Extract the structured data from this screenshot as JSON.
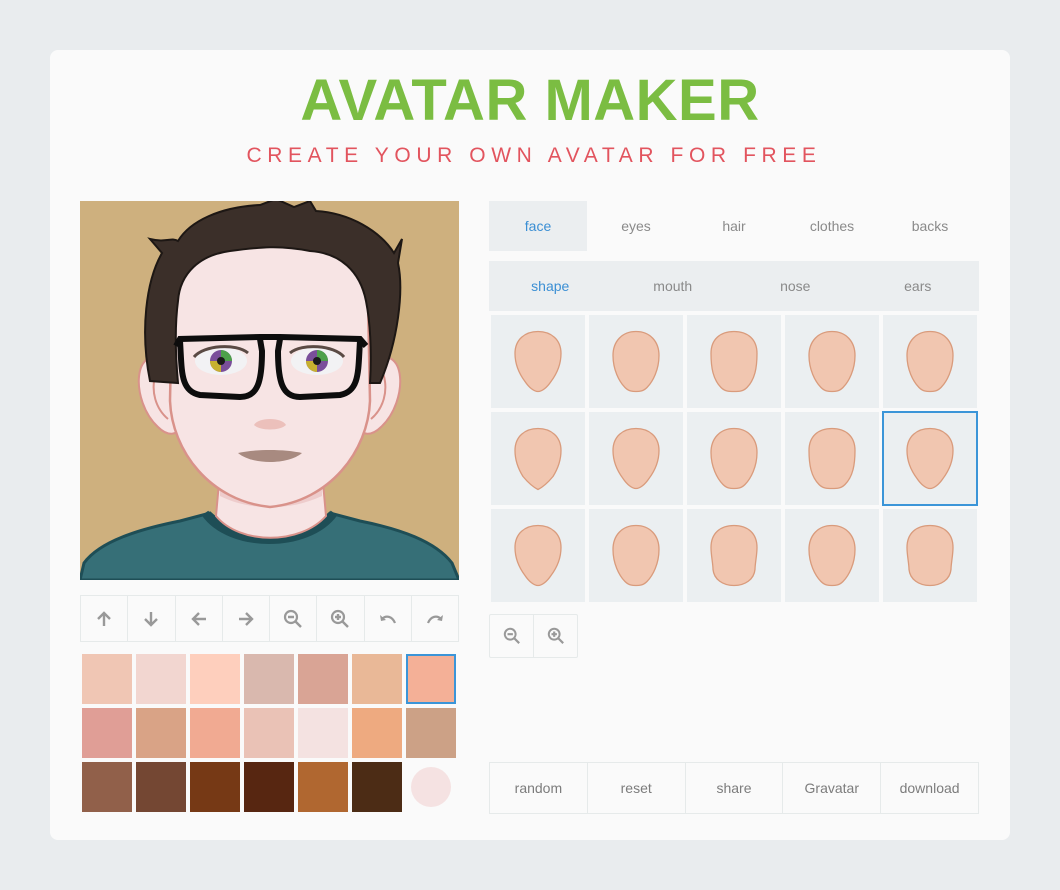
{
  "header": {
    "title": "AVATAR MAKER",
    "subtitle": "CREATE YOUR OWN AVATAR FOR FREE"
  },
  "colors": {
    "title": "#7bbd42",
    "subtitle": "#e2545e",
    "accent": "#3b8fd4",
    "selection_border": "#3b95d8",
    "avatar_background": "#ceb07e",
    "face_shape_fill": "#f1c6b0",
    "face_shape_stroke": "#d99b7c"
  },
  "avatar": {
    "alt": "avatar-preview",
    "features": {
      "hair": "dark brown spiky",
      "glasses": "black square frames",
      "eyes": "multicolor iris",
      "clothes": "teal t-shirt",
      "skin": "#f7e4e4"
    }
  },
  "move_toolbar": [
    {
      "name": "move-up-button",
      "icon": "arrow-up-icon"
    },
    {
      "name": "move-down-button",
      "icon": "arrow-down-icon"
    },
    {
      "name": "move-left-button",
      "icon": "arrow-left-icon"
    },
    {
      "name": "move-right-button",
      "icon": "arrow-right-icon"
    },
    {
      "name": "zoom-out-button",
      "icon": "zoom-out-icon"
    },
    {
      "name": "zoom-in-button",
      "icon": "zoom-in-icon"
    },
    {
      "name": "rotate-left-button",
      "icon": "undo-icon"
    },
    {
      "name": "rotate-right-button",
      "icon": "redo-icon"
    }
  ],
  "palette": {
    "selected_index": 6,
    "swatches": [
      "#f0c6b4",
      "#f2d6d0",
      "#fecfbd",
      "#d9b8ae",
      "#d9a495",
      "#e9b897",
      "#f4b097",
      "#e09e96",
      "#d9a386",
      "#f1aa92",
      "#eac2b6",
      "#f4e2e1",
      "#eeaa80",
      "#cca186",
      "#91604a",
      "#744733",
      "#763915",
      "#572611",
      "#b06730",
      "#4c2c15",
      "#f5e2e2"
    ]
  },
  "tabs": {
    "active": 0,
    "items": [
      {
        "label": "face"
      },
      {
        "label": "eyes"
      },
      {
        "label": "hair"
      },
      {
        "label": "clothes"
      },
      {
        "label": "backs"
      }
    ]
  },
  "subtabs": {
    "active": 0,
    "items": [
      {
        "label": "shape"
      },
      {
        "label": "mouth"
      },
      {
        "label": "nose"
      },
      {
        "label": "ears"
      }
    ]
  },
  "face_shapes": {
    "selected_index": 9,
    "count": 15,
    "variants": [
      "pointed",
      "oval",
      "round",
      "oval",
      "oval",
      "diamond",
      "pointed",
      "oval",
      "round",
      "pointed",
      "pointed",
      "oval",
      "square",
      "oval",
      "square"
    ]
  },
  "zoom_controls": [
    {
      "name": "shape-zoom-out-button",
      "icon": "zoom-out-icon"
    },
    {
      "name": "shape-zoom-in-button",
      "icon": "zoom-in-icon"
    }
  ],
  "actions": [
    {
      "label": "random"
    },
    {
      "label": "reset"
    },
    {
      "label": "share"
    },
    {
      "label": "Gravatar"
    },
    {
      "label": "download"
    }
  ]
}
